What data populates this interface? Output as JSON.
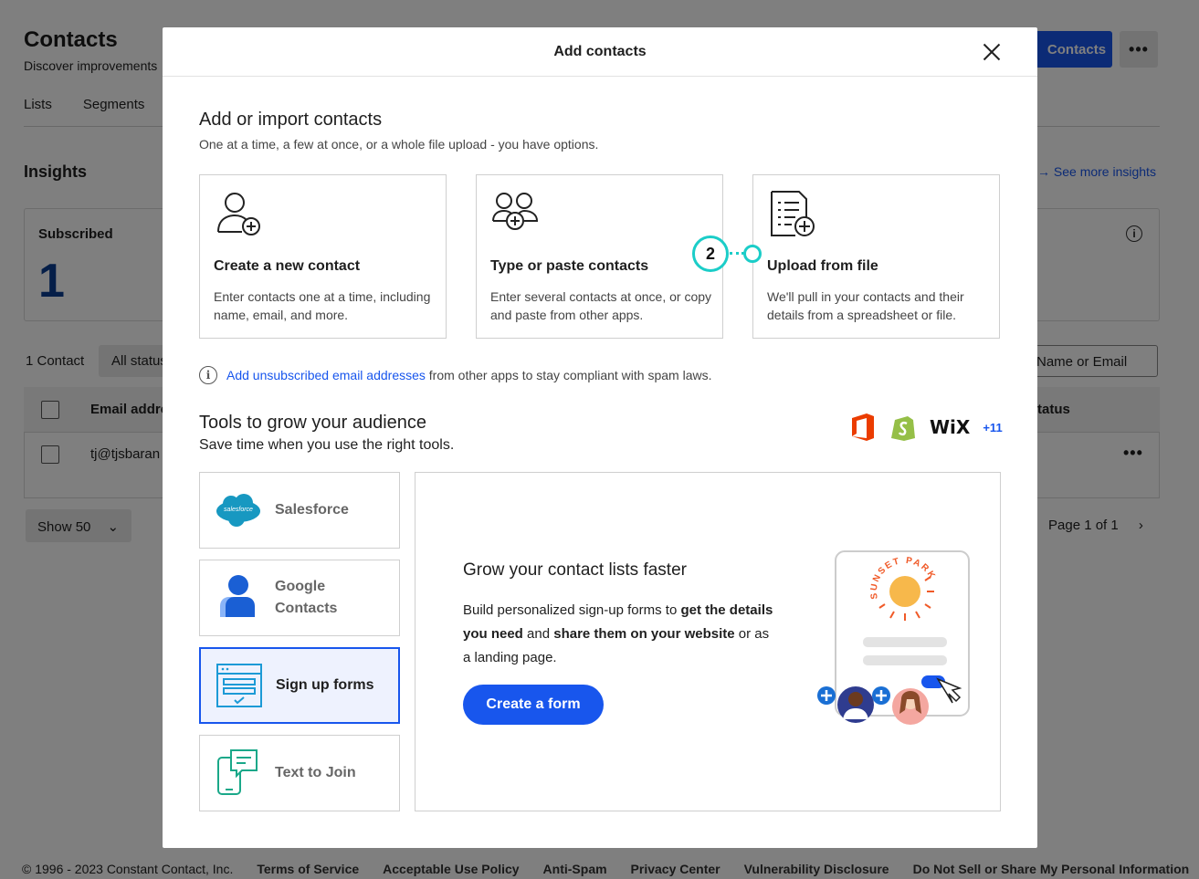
{
  "background": {
    "title": "Contacts",
    "subtitle": "Discover improvements",
    "tabs": [
      "Lists",
      "Segments"
    ],
    "add_button": "Contacts",
    "more": "•••",
    "insights_title": "Insights",
    "see_more": "See more insights",
    "subscribed_label": "Subscribed",
    "subscribed_value": "1",
    "contact_count": "1 Contact",
    "status_filter": "All status",
    "search_filter": "Name or Email",
    "col_email": "Email addre",
    "col_status": "tatus",
    "row_email": "tj@tjsbaran",
    "row_more": "•••",
    "show_select": "Show 50",
    "pagination": "Page 1 of 1",
    "footer": {
      "copyright": "© 1996 - 2023 Constant Contact, Inc.",
      "links": [
        "Terms of Service",
        "Acceptable Use Policy",
        "Anti-Spam",
        "Privacy Center",
        "Vulnerability Disclosure",
        "Do Not Sell or Share My Personal Information"
      ]
    }
  },
  "modal": {
    "title": "Add contacts",
    "section_title": "Add or import contacts",
    "section_subtitle": "One at a time, a few at once, or a whole file upload - you have options.",
    "options": [
      {
        "title": "Create a new contact",
        "desc": "Enter contacts one at a time, including name, email, and more.",
        "icon": "add-person-icon"
      },
      {
        "title": "Type or paste contacts",
        "desc": "Enter several contacts at once, or copy and paste from other apps.",
        "icon": "add-people-icon"
      },
      {
        "title": "Upload from file",
        "desc": "We'll pull in your contacts and their details from a spreadsheet or file.",
        "icon": "add-file-icon"
      }
    ],
    "callout_number": "2",
    "notice_icon": "info-icon",
    "notice_link": "Add unsubscribed email addresses",
    "notice_text": " from other apps to stay compliant with spam laws.",
    "tools_title": "Tools to grow your audience",
    "tools_subtitle": "Save time when you use the right tools.",
    "brands_more": "+11",
    "brand_wix": "WiX",
    "tools": [
      {
        "label": "Salesforce",
        "logo_text": "salesforce",
        "icon": "salesforce-icon"
      },
      {
        "label": "Google Contacts",
        "icon": "google-contacts-icon"
      },
      {
        "label": "Sign up forms",
        "icon": "form-icon",
        "active": true
      },
      {
        "label": "Text to Join",
        "icon": "phone-chat-icon"
      }
    ],
    "panel": {
      "title": "Grow your contact lists faster",
      "body_1": "Build personalized sign-up forms to ",
      "body_b1": "get the details you need",
      "body_2": " and ",
      "body_b2": "share them on your website",
      "body_3": " or as a landing page.",
      "button": "Create a form",
      "illus_text": "SUNSET PARK"
    }
  },
  "colors": {
    "accent": "#1856ed",
    "callout": "#1bcdc8",
    "overlay": "rgba(0,0,0,0.5)"
  }
}
